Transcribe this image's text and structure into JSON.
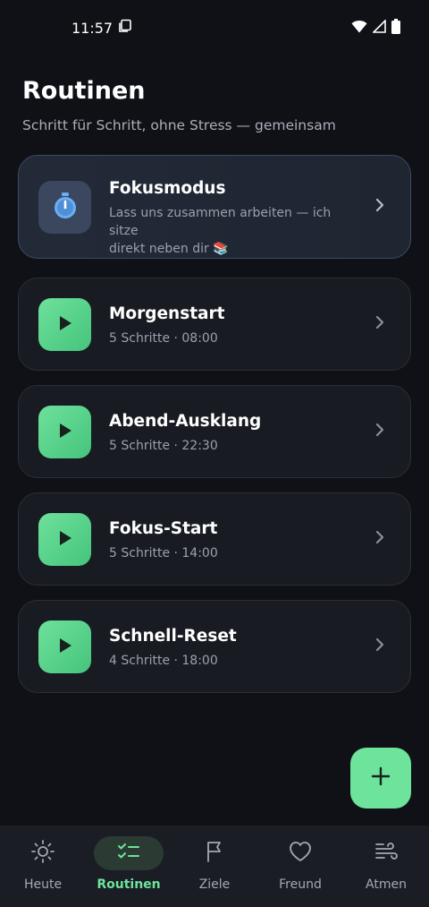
{
  "status_bar": {
    "time": "11:57"
  },
  "header": {
    "title": "Routinen",
    "subtitle": "Schritt für Schritt, ohne Stress — gemeinsam"
  },
  "featured": {
    "title": "Fokusmodus",
    "subtitle_line1": "Lass uns zusammen arbeiten — ich sitze",
    "subtitle_line2": "direkt neben dir 📚",
    "icon": "stopwatch-icon"
  },
  "routines": [
    {
      "title": "Morgenstart",
      "meta": "5 Schritte · 08:00"
    },
    {
      "title": "Abend-Ausklang",
      "meta": "5 Schritte · 22:30"
    },
    {
      "title": "Fokus-Start",
      "meta": "5 Schritte · 14:00"
    },
    {
      "title": "Schnell-Reset",
      "meta": "4 Schritte · 18:00"
    }
  ],
  "fab": {
    "icon": "plus-icon"
  },
  "nav": {
    "items": [
      {
        "label": "Heute",
        "icon": "sun-icon",
        "active": false
      },
      {
        "label": "Routinen",
        "icon": "checklist-icon",
        "active": true
      },
      {
        "label": "Ziele",
        "icon": "flag-icon",
        "active": false
      },
      {
        "label": "Freund",
        "icon": "heart-icon",
        "active": false
      },
      {
        "label": "Atmen",
        "icon": "wind-icon",
        "active": false
      }
    ]
  },
  "colors": {
    "background": "#0f1116",
    "card": "#181b22",
    "accent": "#6ee39b",
    "featured_border": "#3c4a63"
  }
}
